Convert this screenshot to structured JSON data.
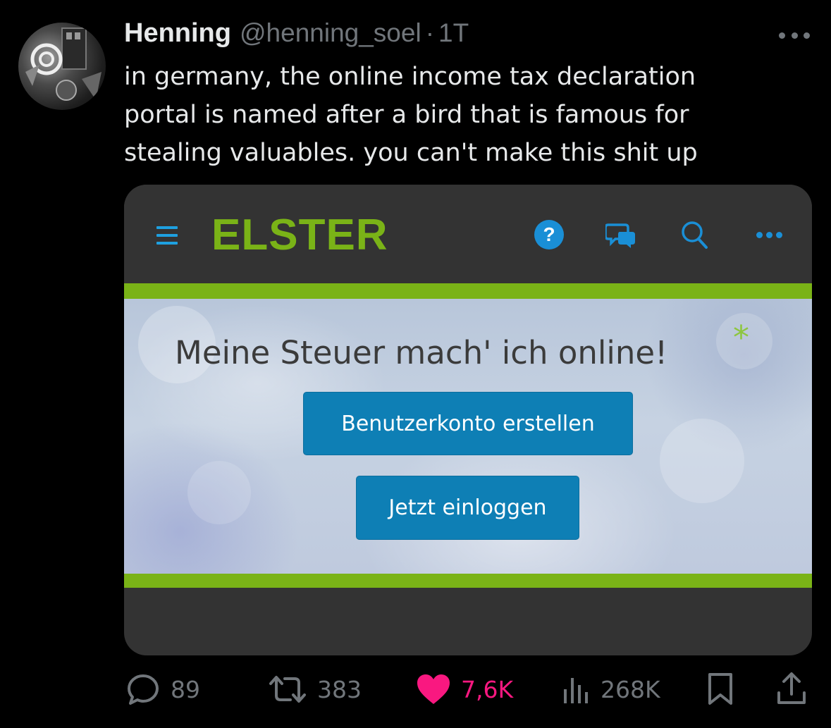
{
  "tweet": {
    "author_name": "Henning",
    "handle": "@henning_soel",
    "separator": "·",
    "time": "1T",
    "text": "in germany, the online income tax declaration portal is named after a bird that is famous for stealing valuables. you can't make this shit up"
  },
  "media": {
    "logo": "ELSTER",
    "help_label": "?",
    "slogan": "Meine Steuer mach' ich online!",
    "star": "*",
    "register_button": "Benutzerkonto erstellen",
    "login_button": "Jetzt einloggen",
    "icons": [
      "menu-icon",
      "help-icon",
      "chat-icon",
      "search-icon",
      "more-dots-icon"
    ],
    "colors": {
      "brand_green": "#7ab317",
      "button_blue": "#0e7fb5",
      "icon_blue": "#1a8fd6"
    }
  },
  "actions": {
    "replies": "89",
    "retweets": "383",
    "likes": "7,6K",
    "views": "268K"
  },
  "colors": {
    "background": "#000000",
    "text": "#e7e9ea",
    "muted": "#71767b",
    "like": "#f91880"
  }
}
